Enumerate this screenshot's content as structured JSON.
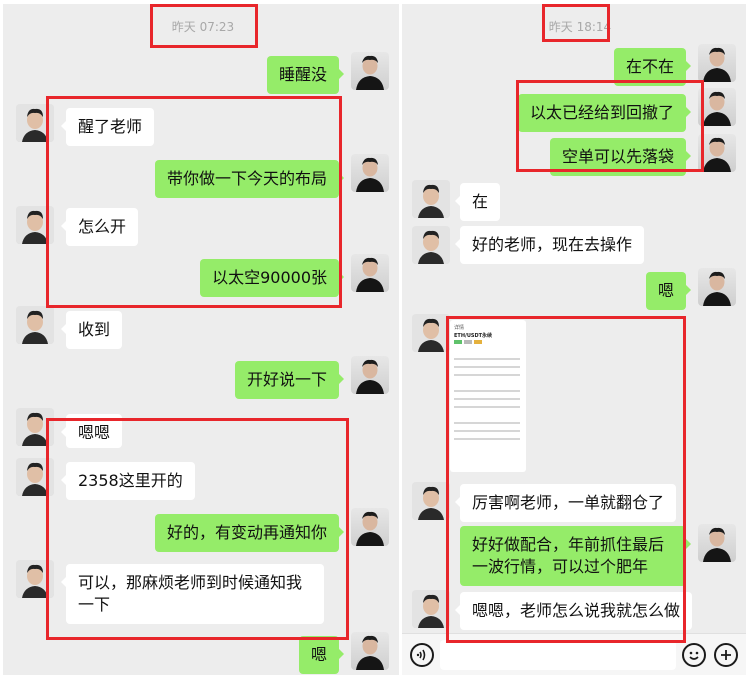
{
  "left_chat": {
    "timestamp": "昨天 07:23",
    "messages": [
      {
        "side": "out",
        "text": "睡醒没"
      },
      {
        "side": "in",
        "text": "醒了老师"
      },
      {
        "side": "out",
        "text": "带你做一下今天的布局"
      },
      {
        "side": "in",
        "text": "怎么开"
      },
      {
        "side": "out",
        "text": "以太空90000张"
      },
      {
        "side": "in",
        "text": "收到"
      },
      {
        "side": "out",
        "text": "开好说一下"
      },
      {
        "side": "in",
        "text": "嗯嗯"
      },
      {
        "side": "in",
        "text": "2358这里开的"
      },
      {
        "side": "out",
        "text": "好的，有变动再通知你"
      },
      {
        "side": "in",
        "text": "可以，那麻烦老师到时候通知我一下"
      },
      {
        "side": "out",
        "text": "嗯"
      }
    ]
  },
  "right_chat": {
    "timestamp": "昨天 18:14",
    "messages": [
      {
        "side": "out",
        "text": "在不在"
      },
      {
        "side": "out",
        "text": "以太已经给到回撤了"
      },
      {
        "side": "out",
        "text": "空单可以先落袋"
      },
      {
        "side": "in",
        "text": "在"
      },
      {
        "side": "in",
        "text": "好的老师，现在去操作"
      },
      {
        "side": "out",
        "text": "嗯"
      },
      {
        "side": "in",
        "text": "[image]"
      },
      {
        "side": "in",
        "text": "厉害啊老师，一单就翻仓了"
      },
      {
        "side": "out",
        "text": "好好做配合，年前抓住最后一波行情，可以过个肥年"
      },
      {
        "side": "in",
        "text": "嗯嗯，老师怎么说我就怎么做"
      }
    ],
    "image_message": {
      "header": "详情",
      "pair": "ETH/USDT永续"
    }
  },
  "icons": {
    "voice": "voice-icon",
    "emoji": "emoji-icon",
    "plus": "plus-icon"
  },
  "colors": {
    "outgoing_bubble": "#95ec69",
    "incoming_bubble": "#ffffff",
    "chat_background": "#ededed",
    "highlight_box": "#e8262b"
  }
}
